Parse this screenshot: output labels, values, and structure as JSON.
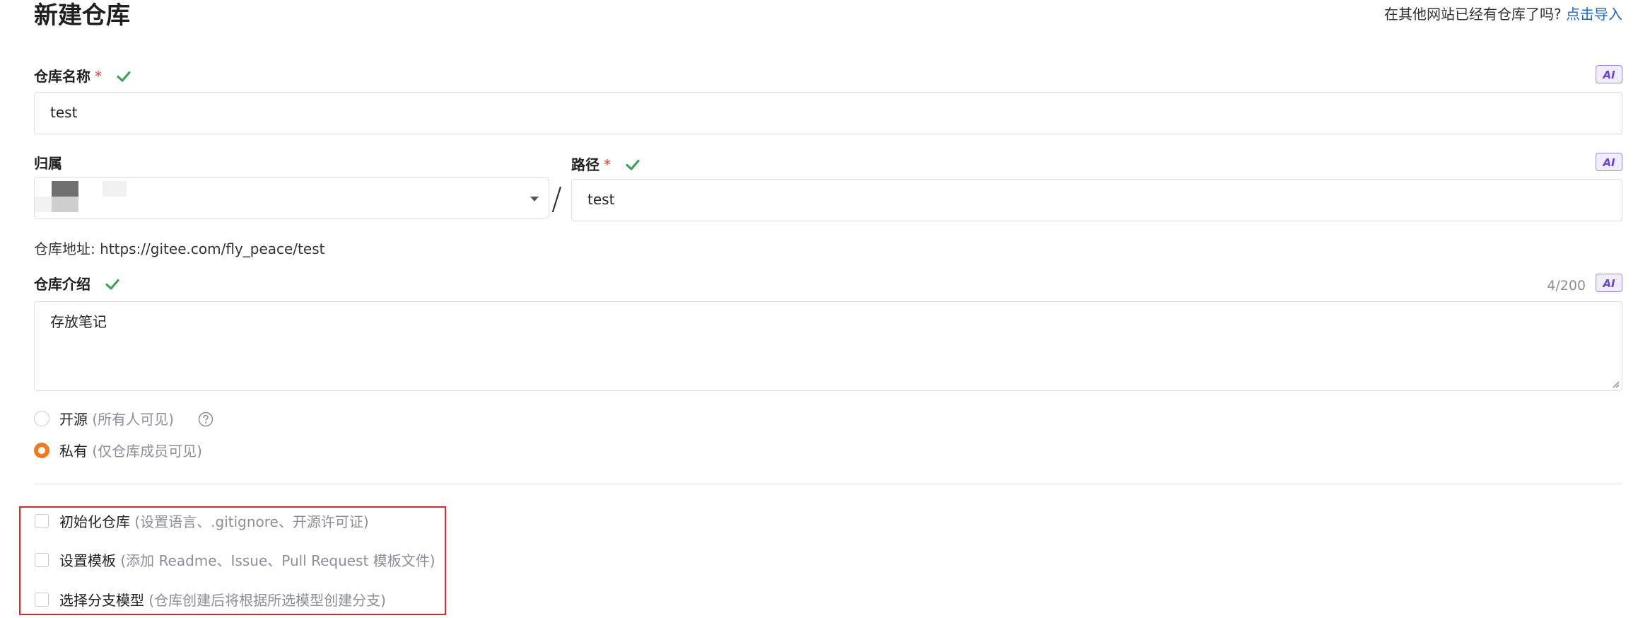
{
  "header": {
    "title": "新建仓库",
    "import_hint": "在其他网站已经有仓库了吗?",
    "import_link": "点击导入"
  },
  "ai_badge_label": "AI",
  "repo_name": {
    "label": "仓库名称",
    "required_mark": "*",
    "value": "test"
  },
  "owner": {
    "label": "归属"
  },
  "path": {
    "label": "路径",
    "required_mark": "*",
    "separator": "/",
    "value": "test"
  },
  "repo_address": {
    "label": "仓库地址:",
    "url": "https://gitee.com/fly_peace/test"
  },
  "description": {
    "label": "仓库介绍",
    "counter": "4/200",
    "value": "存放笔记"
  },
  "visibility": {
    "options": [
      {
        "label": "开源",
        "note": "(所有人可见)",
        "selected": false
      },
      {
        "label": "私有",
        "note": "(仅仓库成员可见)",
        "selected": true
      }
    ]
  },
  "extra_options": [
    {
      "label": "初始化仓库",
      "note": "(设置语言、.gitignore、开源许可证)",
      "checked": false
    },
    {
      "label": "设置模板",
      "note": "(添加 Readme、Issue、Pull Request 模板文件)",
      "checked": false
    },
    {
      "label": "选择分支模型",
      "note": "(仓库创建后将根据所选模型创建分支)",
      "checked": false
    }
  ],
  "colors": {
    "accent_orange": "#f47a1f",
    "link_blue": "#1e66c8",
    "success_green": "#3aa655",
    "required_red": "#e3402e",
    "highlight_red": "#e0282c"
  }
}
